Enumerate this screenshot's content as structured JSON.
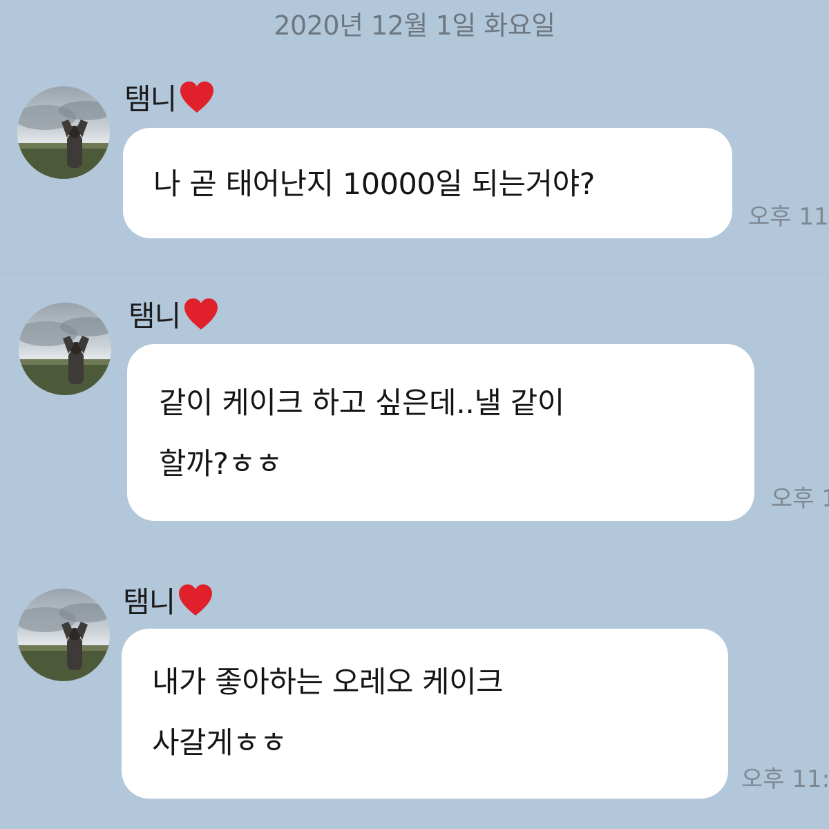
{
  "chat": {
    "date_header": "2020년 12월 1일 화요일",
    "messages": [
      {
        "sender": "탬니",
        "sender_emoji": "heart-icon",
        "text": "나 곧 태어난지 10000일 되는거야?",
        "time": "오후 11"
      },
      {
        "sender": "탬니",
        "sender_emoji": "heart-icon",
        "text": "같이 케이크 하고 싶은데..낼 같이\n할까?ㅎㅎ",
        "time": "오후 1"
      },
      {
        "sender": "탬니",
        "sender_emoji": "heart-icon",
        "text": "내가 좋아하는 오레오 케이크\n사갈게ㅎㅎ",
        "time": "오후 11:"
      }
    ]
  },
  "colors": {
    "background": "#b2c7da",
    "bubble": "#ffffff",
    "heart": "#e0202a"
  }
}
